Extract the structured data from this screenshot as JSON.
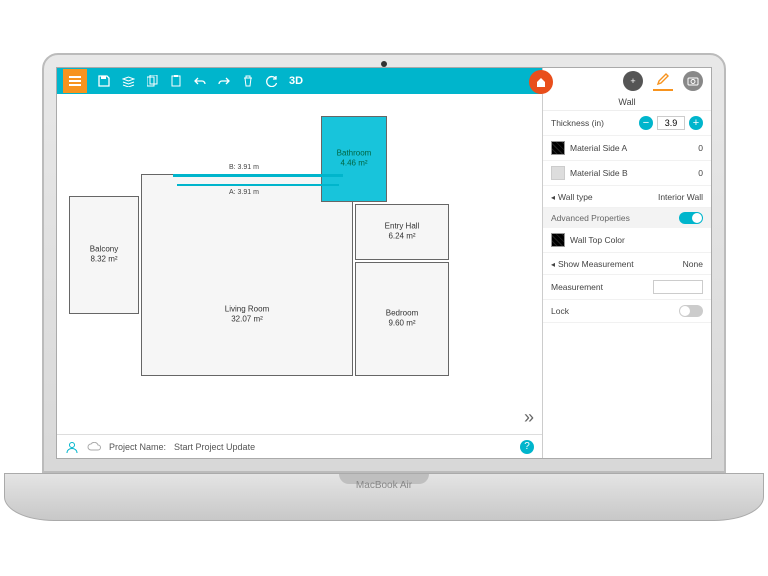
{
  "toolbar": {
    "mode3d": "3D"
  },
  "status": {
    "project_label": "Project Name:",
    "project_name": "Start Project Update"
  },
  "sidepanel": {
    "title": "Wall",
    "thickness_label": "Thickness (in)",
    "thickness_value": "3.9",
    "material_a": "Material Side A",
    "material_a_val": "0",
    "material_b": "Material Side B",
    "material_b_val": "0",
    "wall_type_label": "Wall type",
    "wall_type_value": "Interior Wall",
    "advanced_label": "Advanced Properties",
    "wall_top_color": "Wall Top Color",
    "show_measurement_label": "Show Measurement",
    "show_measurement_value": "None",
    "measurement_label": "Measurement",
    "measurement_value": "",
    "lock_label": "Lock"
  },
  "rooms": {
    "balcony": {
      "name": "Balcony",
      "area": "8.32 m²"
    },
    "living": {
      "name": "Living Room",
      "area": "32.07 m²"
    },
    "bathroom": {
      "name": "Bathroom",
      "area": "4.46 m²"
    },
    "entry": {
      "name": "Entry Hall",
      "area": "6.24 m²"
    },
    "bedroom": {
      "name": "Bedroom",
      "area": "9.60 m²"
    }
  },
  "dims": {
    "b": "B: 3.91 m",
    "a": "A: 3.91 m"
  },
  "device": {
    "brand": "MacBook Air"
  }
}
